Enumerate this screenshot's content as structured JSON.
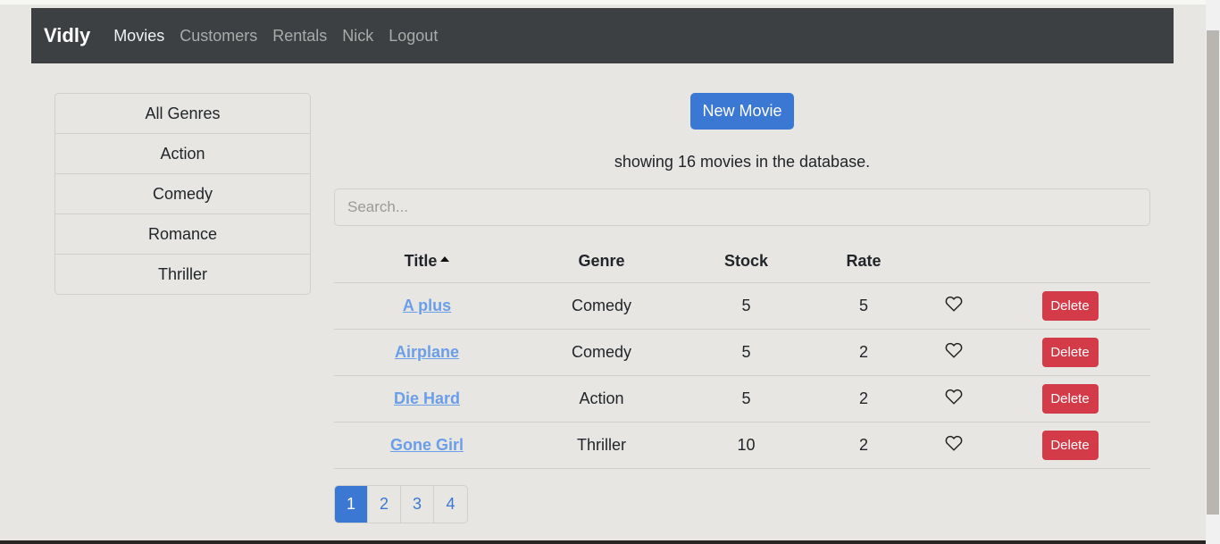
{
  "navbar": {
    "brand": "Vidly",
    "links": [
      "Movies",
      "Customers",
      "Rentals",
      "Nick",
      "Logout"
    ],
    "active": "Movies"
  },
  "genres": [
    "All Genres",
    "Action",
    "Comedy",
    "Romance",
    "Thriller"
  ],
  "main": {
    "new_button": "New Movie",
    "count_text": "showing 16 movies in the database.",
    "search_placeholder": "Search...",
    "table": {
      "headers": {
        "title": "Title",
        "genre": "Genre",
        "stock": "Stock",
        "rate": "Rate"
      },
      "sorted_by": "Title",
      "rows": [
        {
          "title": "A plus",
          "genre": "Comedy",
          "stock": "5",
          "rate": "5"
        },
        {
          "title": "Airplane",
          "genre": "Comedy",
          "stock": "5",
          "rate": "2"
        },
        {
          "title": "Die Hard",
          "genre": "Action",
          "stock": "5",
          "rate": "2"
        },
        {
          "title": "Gone Girl",
          "genre": "Thriller",
          "stock": "10",
          "rate": "2"
        }
      ],
      "delete_label": "Delete"
    },
    "pagination": [
      "1",
      "2",
      "3",
      "4"
    ],
    "active_page": "1"
  },
  "colors": {
    "accent": "#3a78d4",
    "danger": "#d43b48",
    "navbar": "#3c4043",
    "link": "#6b9ee8"
  }
}
